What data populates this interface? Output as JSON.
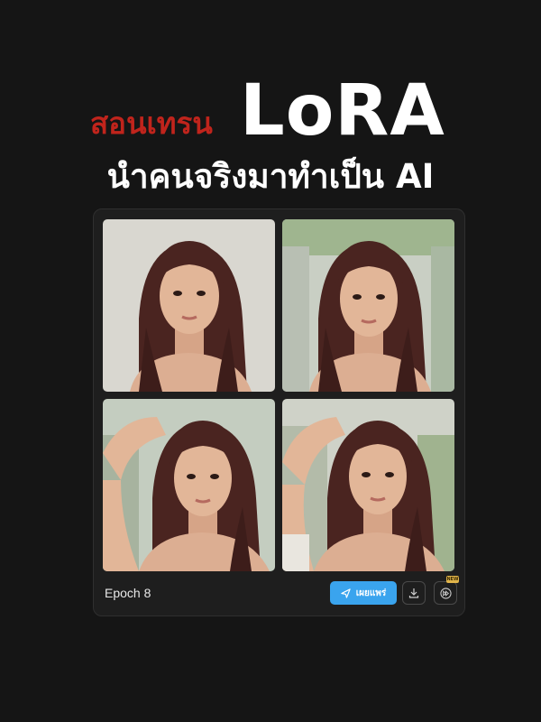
{
  "headline": {
    "thai": "สอนเทรน",
    "lora": "LoRA",
    "sub": "นำคนจริงมาทำเป็น AI"
  },
  "card": {
    "images": [
      {
        "alt": "generated portrait 1"
      },
      {
        "alt": "generated portrait 2"
      },
      {
        "alt": "generated portrait 3"
      },
      {
        "alt": "generated portrait 4"
      }
    ],
    "epoch_label": "Epoch 8",
    "share_label": "เผยแพร่",
    "new_badge": "NEW"
  },
  "colors": {
    "background": "#151515",
    "accent_red": "#c0241c",
    "share_blue": "#3aa4ee",
    "badge_gold": "#e0b44a"
  }
}
